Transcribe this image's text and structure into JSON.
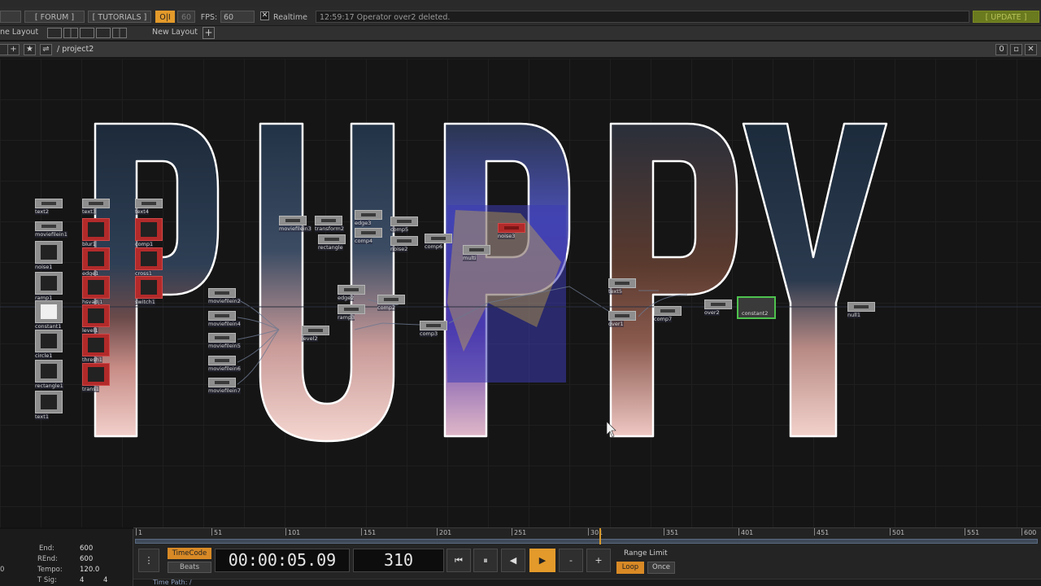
{
  "menubar": {
    "forum": "[ FORUM ]",
    "tutorials": "[ TUTORIALS ]",
    "oi": "O|I",
    "sixty": "60",
    "fps_label": "FPS:",
    "fps_value": "60",
    "realtime": "Realtime",
    "realtime_checked": "✕",
    "status": "12:59:17 Operator over2 deleted.",
    "update": "[ UPDATE ]"
  },
  "layoutbar": {
    "pane_layout": "ne Layout",
    "new_layout": "New Layout",
    "add": "+"
  },
  "pathbar": {
    "plus": "+",
    "star": "★",
    "path": "/ project2",
    "zero": "0"
  },
  "canvas": {
    "artwork_text": "PUPPY",
    "nodes": [
      {
        "name": "text2",
        "label": "text2"
      },
      {
        "name": "moviefilein1",
        "label": "moviefilein1"
      },
      {
        "name": "noise1",
        "label": "noise1"
      },
      {
        "name": "ramp1",
        "label": "ramp1"
      },
      {
        "name": "constant1",
        "label": "constant1"
      },
      {
        "name": "circle1",
        "label": "circle1"
      },
      {
        "name": "rectangle1",
        "label": "rectangle1"
      },
      {
        "name": "text1",
        "label": "text1"
      },
      {
        "name": "text3",
        "label": "text3"
      },
      {
        "name": "blur1",
        "label": "blur1"
      },
      {
        "name": "edge1",
        "label": "edge1"
      },
      {
        "name": "hsvadj1",
        "label": "hsvadj1"
      },
      {
        "name": "level1",
        "label": "level1"
      },
      {
        "name": "thresh1",
        "label": "thresh1"
      },
      {
        "name": "trans1",
        "label": "trans1"
      },
      {
        "name": "text4",
        "label": "text4"
      },
      {
        "name": "comp1",
        "label": "comp1"
      },
      {
        "name": "cross1",
        "label": "cross1"
      },
      {
        "name": "switch1",
        "label": "switch1"
      },
      {
        "name": "moviefilein2",
        "label": "moviefilein2"
      },
      {
        "name": "moviefilein4",
        "label": "moviefilein4"
      },
      {
        "name": "moviefilein5",
        "label": "moviefilein5"
      },
      {
        "name": "moviefilein6",
        "label": "moviefilein6"
      },
      {
        "name": "moviefilein7",
        "label": "moviefilein7"
      },
      {
        "name": "moviefilein3",
        "label": "moviefilein3"
      },
      {
        "name": "transform2",
        "label": "transform2"
      },
      {
        "name": "rectangle",
        "label": "rectangle"
      },
      {
        "name": "edge3",
        "label": "edge3"
      },
      {
        "name": "comp4",
        "label": "comp4"
      },
      {
        "name": "comp5",
        "label": "comp5"
      },
      {
        "name": "noise2",
        "label": "noise2"
      },
      {
        "name": "comp6",
        "label": "comp6"
      },
      {
        "name": "noise3",
        "label": "noise3"
      },
      {
        "name": "multi",
        "label": "multi"
      },
      {
        "name": "edge2",
        "label": "edge2"
      },
      {
        "name": "ramp3",
        "label": "ramp3"
      },
      {
        "name": "comp2",
        "label": "comp2"
      },
      {
        "name": "level2",
        "label": "level2"
      },
      {
        "name": "comp3",
        "label": "comp3"
      },
      {
        "name": "text5",
        "label": "text5"
      },
      {
        "name": "over1",
        "label": "over1"
      },
      {
        "name": "comp7",
        "label": "comp7"
      },
      {
        "name": "over2",
        "label": "over2"
      },
      {
        "name": "constant2",
        "label": "constant2"
      },
      {
        "name": "null1",
        "label": "null1"
      }
    ]
  },
  "timeline": {
    "ticks": [
      "1",
      "51",
      "101",
      "151",
      "201",
      "251",
      "301",
      "351",
      "401",
      "451",
      "501",
      "551",
      "600"
    ],
    "end_label": "End:",
    "end_value": "600",
    "rend_label": "REnd:",
    "rend_value": "600",
    "tempo_label": "Tempo:",
    "tempo_value": "120.0",
    "tsig_label": "T Sig:",
    "tsig_a": "4",
    "tsig_b": "4",
    "left_zero": "0",
    "timecode_btn": "TimeCode",
    "beats_btn": "Beats",
    "timecode": "00:00:05.09",
    "frame": "310",
    "range_limit": "Range Limit",
    "loop": "Loop",
    "once": "Once",
    "time_path": "Time Path: /",
    "btn_rewind": "⏮",
    "btn_pause": "⏸",
    "btn_back": "◀",
    "btn_play": "▶",
    "btn_minus": "-",
    "btn_plus": "+",
    "btn_menu": "⋮"
  }
}
